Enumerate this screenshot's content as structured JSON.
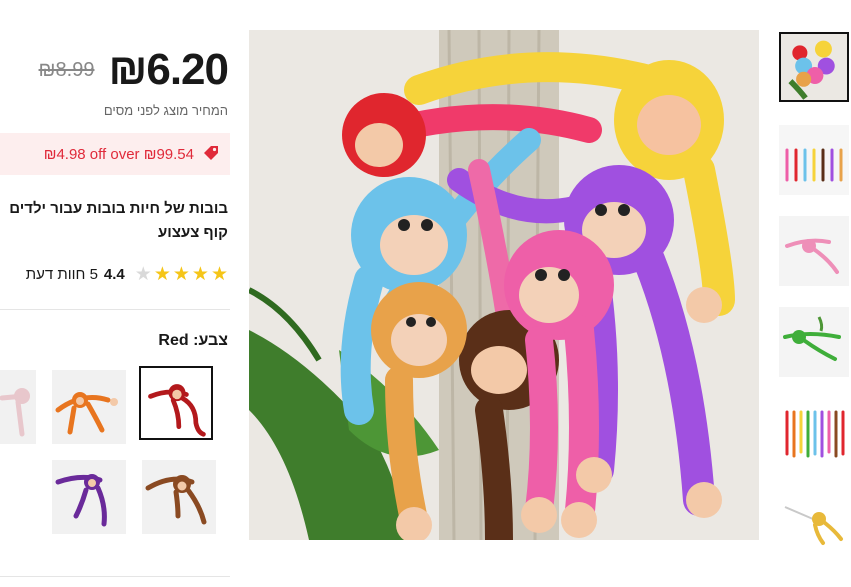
{
  "price": {
    "current": "₪6.20",
    "original": "₪8.99",
    "tax_note": "המחיר מוצג לפני מסים"
  },
  "promo": {
    "text": "₪4.98 off over ₪99.54",
    "icon": "tag-icon"
  },
  "product": {
    "title_line1": "בובות של חיות בובות עבור ילדים",
    "title_line2": "קוף צעצוע"
  },
  "rating": {
    "value": "4.4",
    "stars_filled": 4.4,
    "stars_total": 5,
    "reviews": "5 חוות דעת"
  },
  "color": {
    "label": "צבע:",
    "selected": "Red"
  },
  "swatches": [
    {
      "name": "red",
      "color": "#b3191c"
    },
    {
      "name": "orange",
      "color": "#e8751f"
    },
    {
      "name": "pink",
      "color": "#e8c7cc"
    },
    {
      "name": "brown",
      "color": "#8a4a22"
    },
    {
      "name": "purple",
      "color": "#6a2a9a"
    }
  ],
  "thumbnails": [
    {
      "name": "group",
      "selected": true
    },
    {
      "name": "row-hanging"
    },
    {
      "name": "pink-monkey"
    },
    {
      "name": "green-monkey"
    },
    {
      "name": "rainbow-row"
    },
    {
      "name": "yellow-monkey"
    }
  ],
  "colors": {
    "accent": "#e02a3a",
    "star": "#f5c518"
  }
}
